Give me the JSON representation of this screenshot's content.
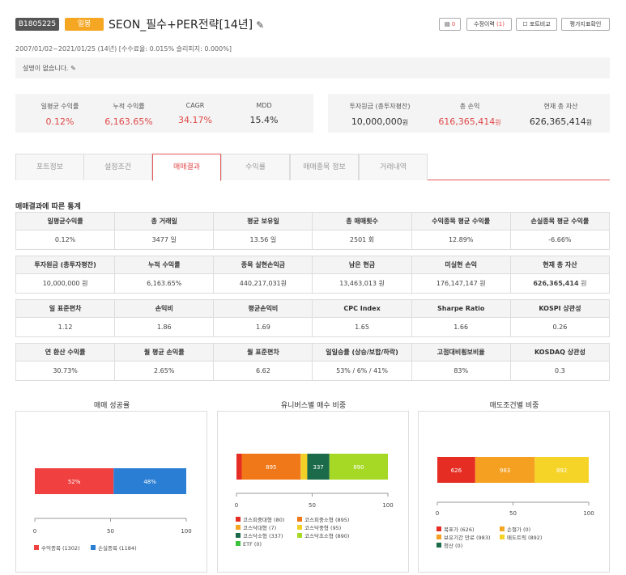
{
  "header": {
    "id": "B1805225",
    "period_badge": "일봉",
    "title": "SEON_필수+PER전략[14년]",
    "meta": "2007/01/02~2021/01/25 (14년) [수수료율: 0.015% 슬리피지: 0.000%]",
    "description": "설명이 없습니다.",
    "buttons": {
      "memo_count": "0",
      "revision_label": "수정이력",
      "revision_count": "(1)",
      "compare_label": "포트비교",
      "eval_label": "평가지표확인"
    }
  },
  "summary": {
    "left": [
      {
        "label": "일평균 수익률",
        "value": "0.12%"
      },
      {
        "label": "누적 수익률",
        "value": "6,163.65%"
      },
      {
        "label": "CAGR",
        "value": "34.17%"
      },
      {
        "label": "MDD",
        "value": "15.4%"
      }
    ],
    "right": [
      {
        "label": "투자원금 (총투자평잔)",
        "value": "10,000,000",
        "unit": "원"
      },
      {
        "label": "총 손익",
        "value": "616,365,414",
        "unit": "원"
      },
      {
        "label": "현재 총 자산",
        "value": "626,365,414",
        "unit": "원"
      }
    ]
  },
  "tabs": [
    "포트정보",
    "설정조건",
    "매매결과",
    "수익률",
    "매매종목 정보",
    "거래내역"
  ],
  "section_title": "매매결과에 따른 통계",
  "stats": [
    {
      "headers": [
        "일평균수익률",
        "총 거래일",
        "평균 보유일",
        "총 매매횟수",
        "수익종목 평균 수익률",
        "손실종목 평균 수익률"
      ],
      "values": [
        "0.12%",
        "3477 일",
        "13.56 일",
        "2501 회",
        "12.89%",
        "-6.66%"
      ]
    },
    {
      "headers": [
        "투자원금 (총투자평잔)",
        "누적 수익률",
        "종목 실현손익금",
        "남은 현금",
        "미실현 손익",
        "현재 총 자산"
      ],
      "values": [
        "10,000,000 원",
        "6,163.65%",
        "440,217,031원",
        "13,463,013 원",
        "176,147,147 원",
        "626,365,414"
      ],
      "last_unit": "원"
    },
    {
      "headers": [
        "일 표준편차",
        "손익비",
        "평균손익비",
        "CPC Index",
        "Sharpe Ratio",
        "KOSPI 상관성"
      ],
      "values": [
        "1.12",
        "1.86",
        "1.69",
        "1.65",
        "1.66",
        "0.26"
      ]
    },
    {
      "headers": [
        "연 환산 수익률",
        "월 평균 손익률",
        "월 표준편차",
        "일일승률 (상승/보합/하락)",
        "고점대비횡보비율",
        "KOSDAQ 상관성"
      ],
      "values": [
        "30.73%",
        "2.65%",
        "6.62",
        "53% / 6% / 41%",
        "83%",
        "0.3"
      ]
    }
  ],
  "colors": {
    "red": "#e04848",
    "blue": "#3a7bd5",
    "orange": "#f5a623"
  },
  "chart_data": [
    {
      "type": "bar",
      "title": "매매 성공률",
      "orientation": "horizontal-stacked",
      "xlim": [
        0,
        100
      ],
      "xticks": [
        "0",
        "50",
        "100"
      ],
      "series": [
        {
          "name": "수익종목 (1302)",
          "values": [
            52
          ],
          "label": "52%",
          "color": "#f04040"
        },
        {
          "name": "손실종목 (1184)",
          "values": [
            48
          ],
          "label": "48%",
          "color": "#2a7fd4"
        }
      ]
    },
    {
      "type": "bar",
      "title": "유니버스별 매수 비중",
      "orientation": "horizontal-stacked",
      "xlim": [
        0,
        100
      ],
      "xticks": [
        "0",
        "50",
        "100"
      ],
      "series": [
        {
          "name": "코스피중대형 (80)",
          "values": [
            80
          ],
          "label": "",
          "color": "#e52d24"
        },
        {
          "name": "코스피중소형 (895)",
          "values": [
            895
          ],
          "label": "895",
          "color": "#f07818"
        },
        {
          "name": "코스닥대형 (7)",
          "values": [
            7
          ],
          "label": "",
          "color": "#f5a623"
        },
        {
          "name": "코스닥중형 (95)",
          "values": [
            95
          ],
          "label": "",
          "color": "#f2d027"
        },
        {
          "name": "코스닥소형 (337)",
          "values": [
            337
          ],
          "label": "337",
          "color": "#1b6b4a"
        },
        {
          "name": "코스닥초소형 (890)",
          "values": [
            890
          ],
          "label": "890",
          "color": "#a6d925"
        },
        {
          "name": "ETF (0)",
          "values": [
            0
          ],
          "label": "",
          "color": "#3cc23c"
        }
      ]
    },
    {
      "type": "bar",
      "title": "매도조건별 비중",
      "orientation": "horizontal-stacked",
      "xlim": [
        0,
        100
      ],
      "xticks": [
        "0",
        "50",
        "100"
      ],
      "series": [
        {
          "name": "목표가 (626)",
          "values": [
            626
          ],
          "label": "626",
          "color": "#e52d24"
        },
        {
          "name": "손절가 (0)",
          "values": [
            0
          ],
          "label": "",
          "color": "#f5a623"
        },
        {
          "name": "보유기간 만료 (983)",
          "values": [
            983
          ],
          "label": "983",
          "color": "#f5a020"
        },
        {
          "name": "매도트릭 (892)",
          "values": [
            892
          ],
          "label": "892",
          "color": "#f5d327"
        },
        {
          "name": "청산 (0)",
          "values": [
            0
          ],
          "label": "",
          "color": "#1b6b4a"
        }
      ]
    }
  ]
}
